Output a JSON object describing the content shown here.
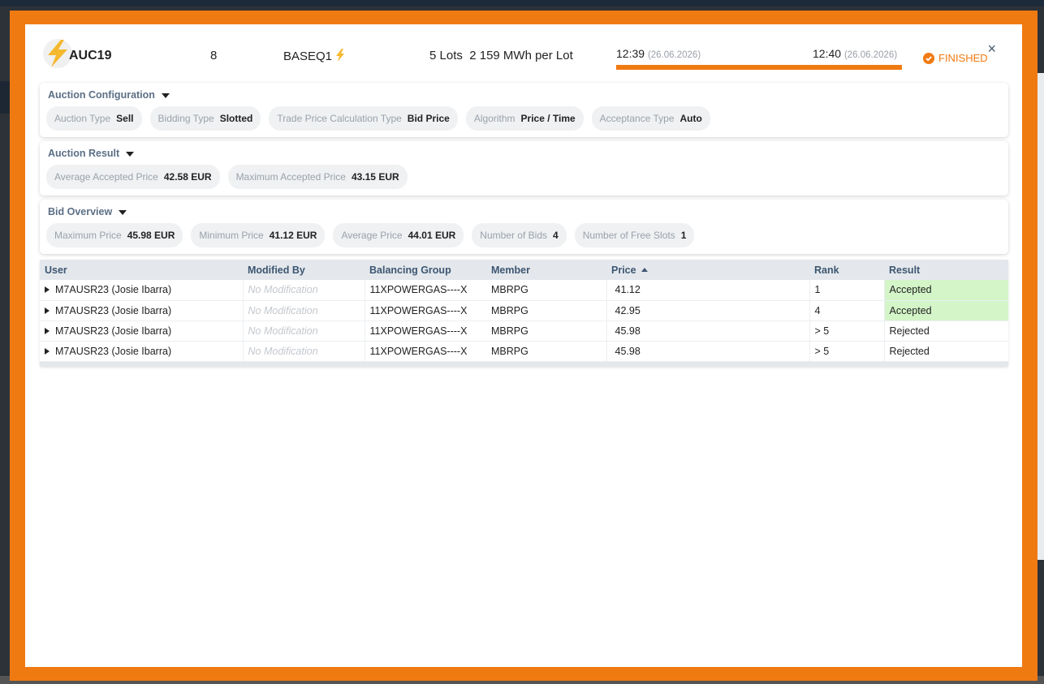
{
  "header": {
    "auction_name": "AUC19",
    "count": "8",
    "product": "BASEQ1",
    "lots": "5 Lots",
    "mwh_per_lot": "2 159 MWh per Lot",
    "start_time": "12:39",
    "start_date": "(26.06.2026)",
    "end_time": "12:40",
    "end_date": "(26.06.2026)",
    "progress": 1.0,
    "status": "FINISHED",
    "close_label": "×"
  },
  "config": {
    "title": "Auction Configuration",
    "items": [
      {
        "label": "Auction Type",
        "value": "Sell"
      },
      {
        "label": "Bidding Type",
        "value": "Slotted"
      },
      {
        "label": "Trade Price Calculation Type",
        "value": "Bid Price"
      },
      {
        "label": "Algorithm",
        "value": "Price / Time"
      },
      {
        "label": "Acceptance Type",
        "value": "Auto"
      }
    ]
  },
  "result": {
    "title": "Auction Result",
    "items": [
      {
        "label": "Average Accepted Price",
        "value": "42.58 EUR"
      },
      {
        "label": "Maximum Accepted Price",
        "value": "43.15 EUR"
      }
    ]
  },
  "overview": {
    "title": "Bid Overview",
    "items": [
      {
        "label": "Maximum Price",
        "value": "45.98 EUR"
      },
      {
        "label": "Minimum Price",
        "value": "41.12 EUR"
      },
      {
        "label": "Average Price",
        "value": "44.01 EUR"
      },
      {
        "label": "Number of Bids",
        "value": "4"
      },
      {
        "label": "Number of Free Slots",
        "value": "1"
      }
    ]
  },
  "table": {
    "columns": [
      "User",
      "Modified By",
      "Balancing Group",
      "Member",
      "Price",
      "Rank",
      "Result"
    ],
    "rows": [
      {
        "user": "M7AUSR23 (Josie Ibarra)",
        "modified_by": "No Modification",
        "balancing_group": "11XPOWERGAS----X",
        "member": "MBRPG",
        "price": "41.12",
        "rank": "1",
        "result": "Accepted"
      },
      {
        "user": "M7AUSR23 (Josie Ibarra)",
        "modified_by": "No Modification",
        "balancing_group": "11XPOWERGAS----X",
        "member": "MBRPG",
        "price": "42.95",
        "rank": "4",
        "result": "Accepted"
      },
      {
        "user": "M7AUSR23 (Josie Ibarra)",
        "modified_by": "No Modification",
        "balancing_group": "11XPOWERGAS----X",
        "member": "MBRPG",
        "price": "45.98",
        "rank": "> 5",
        "result": "Rejected"
      },
      {
        "user": "M7AUSR23 (Josie Ibarra)",
        "modified_by": "No Modification",
        "balancing_group": "11XPOWERGAS----X",
        "member": "MBRPG",
        "price": "45.98",
        "rank": "> 5",
        "result": "Rejected"
      }
    ]
  },
  "colors": {
    "accent": "#f07a12",
    "accepted_bg": "#d3f5c8",
    "header_text": "#3d5671"
  },
  "icons": {
    "auction": "lightning-bolt-icon",
    "product": "lightning-bolt-icon",
    "status": "check-circle-icon",
    "close": "close-icon",
    "section_toggle": "caret-down-icon",
    "sort": "sort-asc-icon",
    "row_expand": "caret-right-icon"
  }
}
